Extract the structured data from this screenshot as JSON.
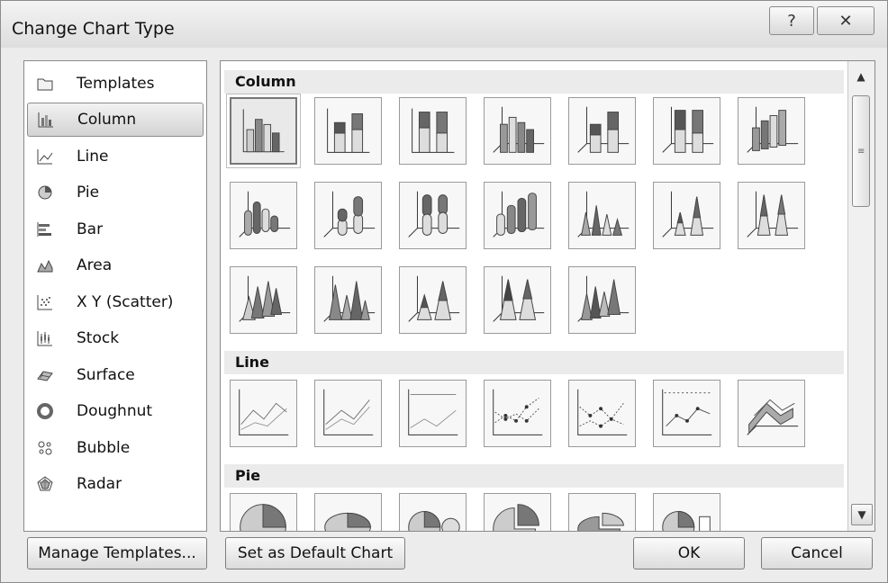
{
  "window": {
    "title": "Change Chart Type",
    "help_glyph": "?",
    "close_glyph": "✕"
  },
  "categories": [
    {
      "label": "Templates",
      "icon": "folder-icon"
    },
    {
      "label": "Column",
      "icon": "column-chart-icon",
      "selected": true
    },
    {
      "label": "Line",
      "icon": "line-chart-icon"
    },
    {
      "label": "Pie",
      "icon": "pie-chart-icon"
    },
    {
      "label": "Bar",
      "icon": "bar-chart-icon"
    },
    {
      "label": "Area",
      "icon": "area-chart-icon"
    },
    {
      "label": "X Y (Scatter)",
      "icon": "scatter-chart-icon"
    },
    {
      "label": "Stock",
      "icon": "stock-chart-icon"
    },
    {
      "label": "Surface",
      "icon": "surface-chart-icon"
    },
    {
      "label": "Doughnut",
      "icon": "doughnut-chart-icon"
    },
    {
      "label": "Bubble",
      "icon": "bubble-chart-icon"
    },
    {
      "label": "Radar",
      "icon": "radar-chart-icon"
    }
  ],
  "sections": {
    "column": "Column",
    "line": "Line",
    "pie": "Pie"
  },
  "buttons": {
    "manage_templates": "Manage Templates...",
    "set_default": "Set as Default Chart",
    "ok": "OK",
    "cancel": "Cancel"
  },
  "colors": {
    "dialog_bg": "#ececec",
    "panel_bg": "#ffffff",
    "selected_bg": "#d3d3d3"
  }
}
